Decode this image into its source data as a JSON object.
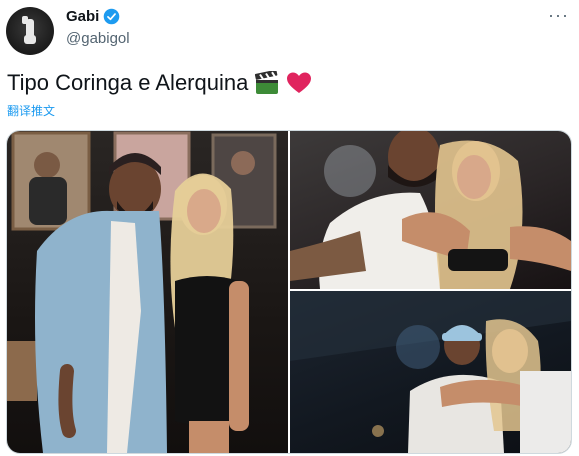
{
  "author": {
    "display_name": "Gabi",
    "handle": "@gabigol",
    "verified_icon": "verified-badge-icon"
  },
  "menu": {
    "more_label": "···"
  },
  "tweet": {
    "text": "Tipo Coringa e Alerquina",
    "emojis": [
      "clapper-board-emoji",
      "red-heart-emoji"
    ],
    "translate_label": "翻译推文"
  },
  "media": {
    "photos": [
      {
        "name": "photo-couple-portrait"
      },
      {
        "name": "photo-couple-embrace"
      },
      {
        "name": "photo-couple-party"
      }
    ]
  },
  "colors": {
    "link": "#1d9bf0",
    "verified": "#1d9bf0",
    "heart": "#e0245e",
    "secondary_text": "#536471"
  }
}
